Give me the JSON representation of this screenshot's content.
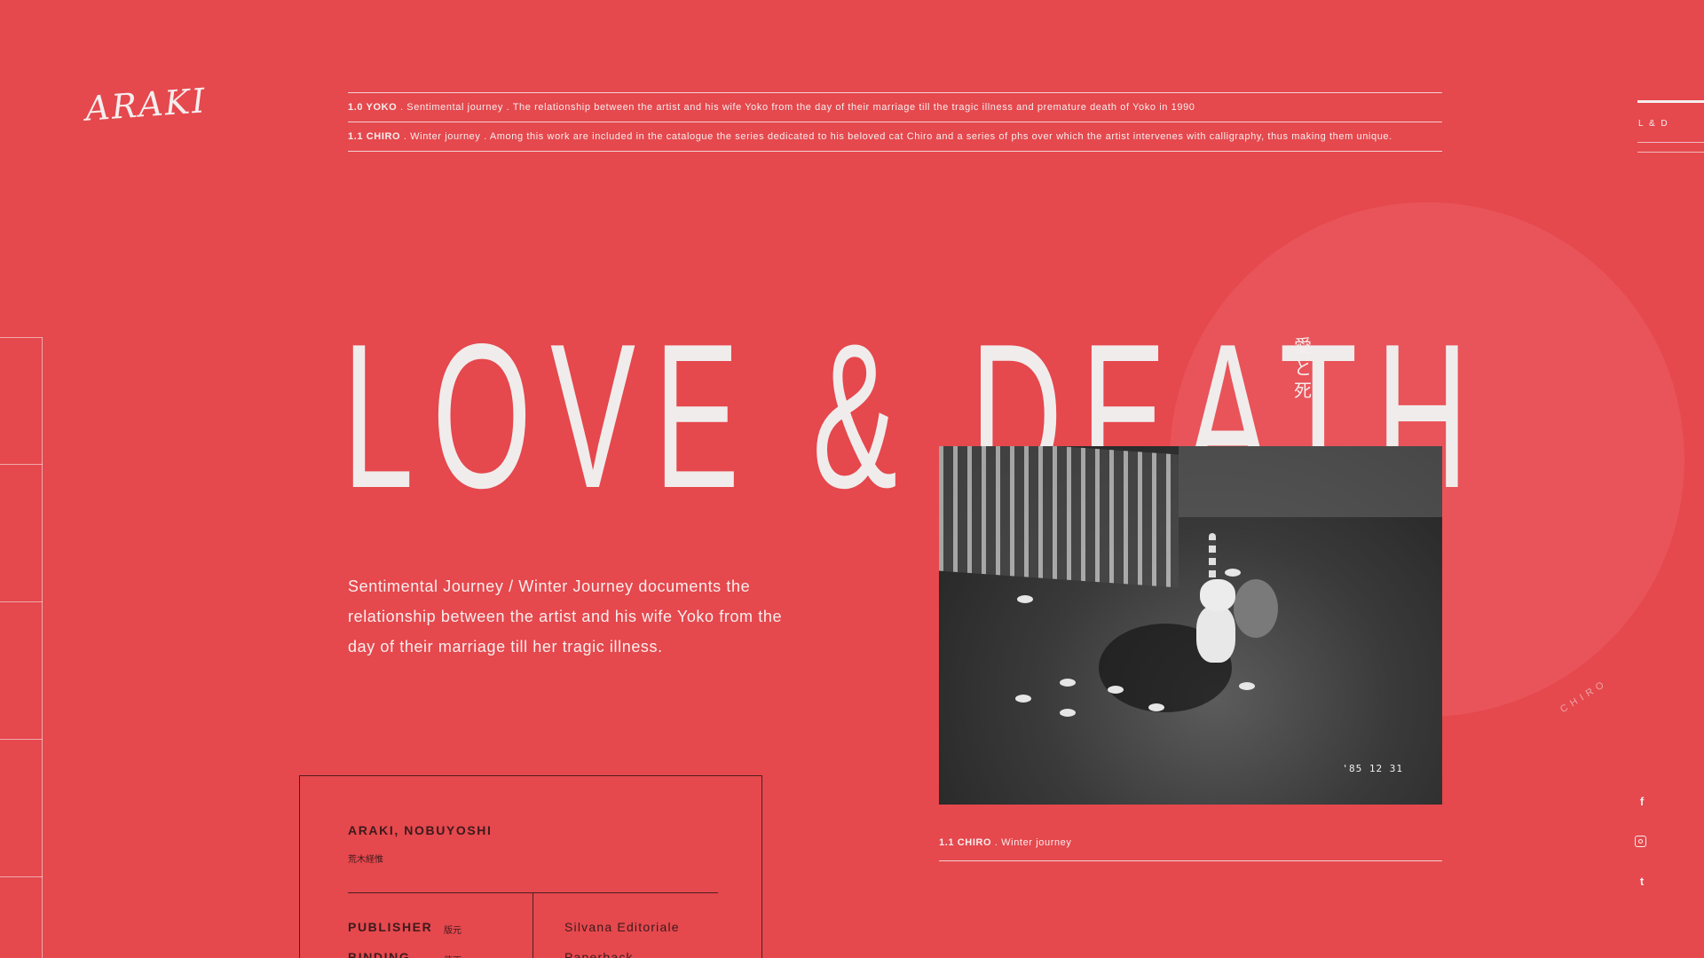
{
  "logo": {
    "text": "ARAKI"
  },
  "notes": [
    {
      "code": "1.0 YOKO",
      "text": " . Sentimental journey . The relationship between the artist and his wife Yoko from the day of their marriage till the tragic illness and premature death of Yoko in 1990"
    },
    {
      "code": "1.1 CHIRO",
      "text": " . Winter journey . Among this work are included in the catalogue the series dedicated to his beloved cat Chiro and a series of phs over which the artist intervenes with calligraphy, thus making them unique."
    }
  ],
  "side_menu": {
    "label": "L & D"
  },
  "headline": "LOVE & DEATH",
  "kanji": [
    "愛",
    "と",
    "死"
  ],
  "description": "Sentimental Journey / Winter Journey documents the relationship between the artist and his wife Yoko from the day of their marriage till her tragic illness.",
  "photo": {
    "date_stamp": "'85 12 31"
  },
  "caption": {
    "code": "1.1 CHIRO",
    "text": " . Winter journey"
  },
  "rotated_label": "CHIRO",
  "socials": [
    "f",
    "t"
  ],
  "info": {
    "author": "ARAKI, NOBUYOSHI",
    "author_jp": "荒木経惟",
    "rows": [
      {
        "label": "PUBLISHER",
        "jp": "版元",
        "value": "Silvana Editoriale"
      },
      {
        "label": "BINDING",
        "jp": "装丁",
        "value": "Paperback"
      }
    ]
  },
  "colors": {
    "background": "#e5484d",
    "circle": "#e8545a",
    "text_light": "#f5eeee",
    "text_dark": "#3c1a1c"
  }
}
